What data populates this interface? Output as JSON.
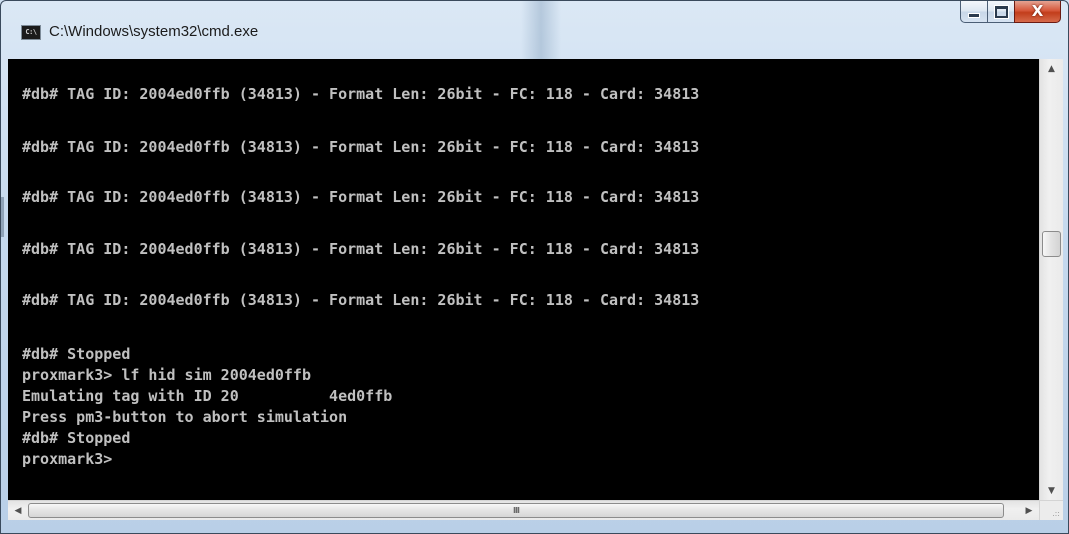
{
  "window": {
    "title": "C:\\Windows\\system32\\cmd.exe",
    "app_icon_text": "C:\\",
    "buttons": {
      "minimize": "minimize",
      "maximize": "maximize",
      "close": "X"
    }
  },
  "console": {
    "lines": [
      "#db# TAG ID: 2004ed0ffb (34813) - Format Len: 26bit - FC: 118 - Card: 34813",
      "#db# TAG ID: 2004ed0ffb (34813) - Format Len: 26bit - FC: 118 - Card: 34813",
      "#db# TAG ID: 2004ed0ffb (34813) - Format Len: 26bit - FC: 118 - Card: 34813",
      "#db# TAG ID: 2004ed0ffb (34813) - Format Len: 26bit - FC: 118 - Card: 34813",
      "#db# TAG ID: 2004ed0ffb (34813) - Format Len: 26bit - FC: 118 - Card: 34813",
      "#db# Stopped",
      "proxmark3> lf hid sim 2004ed0ffb",
      "Emulating tag with ID 20          4ed0ffb",
      "Press pm3-button to abort simulation",
      "#db# Stopped",
      "proxmark3>"
    ]
  },
  "scrollbars": {
    "up_arrow": "▲",
    "down_arrow": "▼",
    "left_arrow": "◀",
    "right_arrow": "▶",
    "thumb_grip": "III",
    "size_grip": ".::"
  },
  "colors": {
    "console_bg": "#000000",
    "console_fg": "#c0c0c0",
    "close_button": "#c94a2a"
  }
}
